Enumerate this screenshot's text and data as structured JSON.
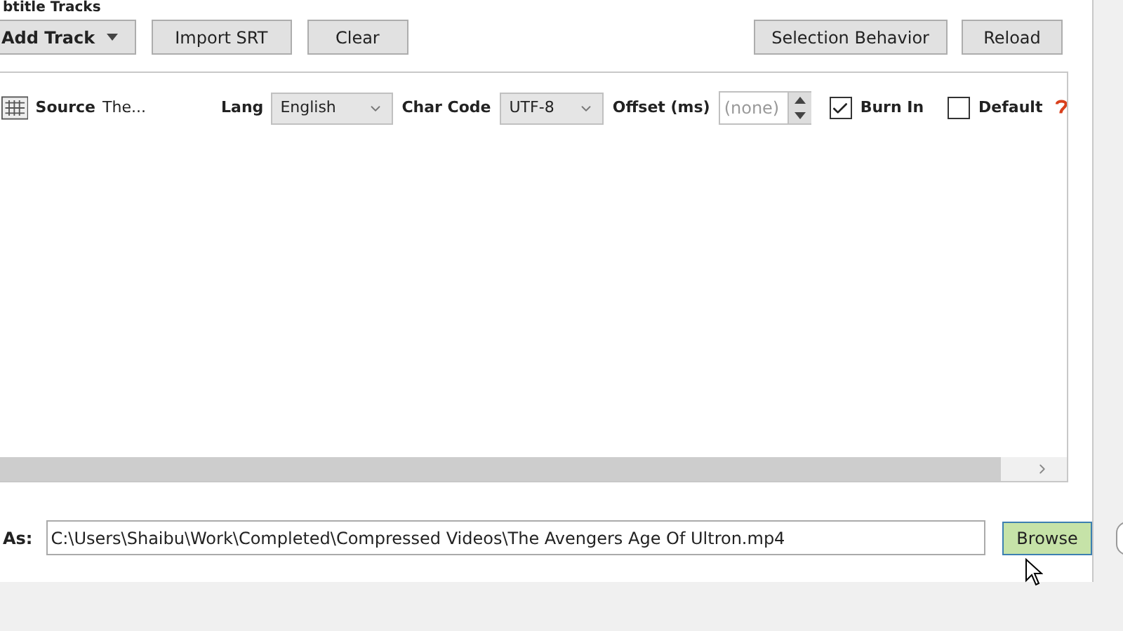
{
  "section_title": "btitle Tracks",
  "toolbar": {
    "left_buttons": [
      {
        "label": "Add Track",
        "kind": "dropdown"
      },
      {
        "label": "Import SRT",
        "kind": "plain"
      },
      {
        "label": "Clear",
        "kind": "plain"
      }
    ],
    "right_buttons": [
      "Selection Behavior",
      "Reload"
    ]
  },
  "tracks": [
    {
      "source_label": "Source",
      "source_name": "The...",
      "lang_label": "Lang",
      "lang": "English",
      "charcode_label": "Char Code",
      "charcode": "UTF-8",
      "offset_label": "Offset (ms)",
      "offset_placeholder": "(none)",
      "burn_in": {
        "label": "Burn In",
        "checked": true
      },
      "default": {
        "label": "Default",
        "checked": false
      }
    }
  ],
  "save_as": {
    "label": "As:",
    "value": "C:\\Users\\Shaibu\\Work\\Completed\\Compressed Videos\\The Avengers Age Of Ultron.mp4",
    "browse": {
      "label": "Browse",
      "hovered": true
    }
  }
}
